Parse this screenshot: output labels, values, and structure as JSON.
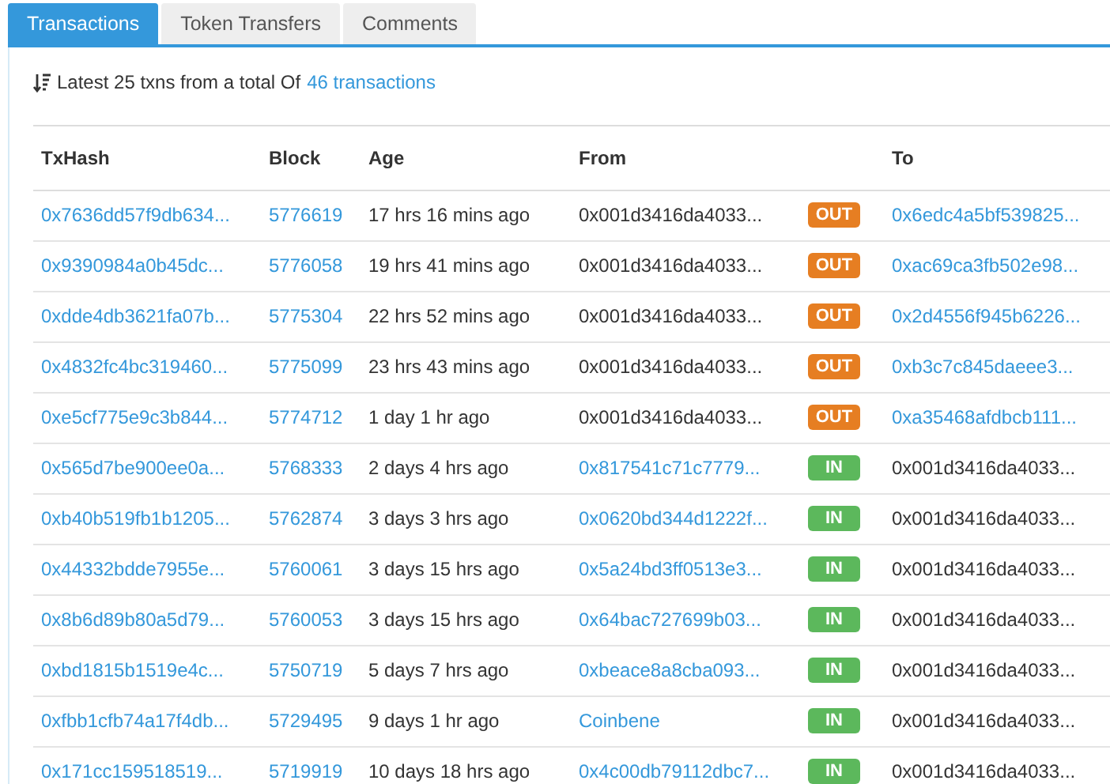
{
  "tabs": [
    {
      "label": "Transactions",
      "selected": true
    },
    {
      "label": "Token Transfers",
      "selected": false
    },
    {
      "label": "Comments",
      "selected": false
    }
  ],
  "summary": {
    "text": "Latest 25 txns from a total Of",
    "link": "46 transactions"
  },
  "table": {
    "columns": [
      "TxHash",
      "Block",
      "Age",
      "From",
      "",
      "To"
    ],
    "rows": [
      {
        "hash": "0x7636dd57f9db634...",
        "block": "5776619",
        "age": "17 hrs 16 mins ago",
        "from": {
          "text": "0x001d3416da4033...",
          "link": false
        },
        "direction": {
          "label": "OUT",
          "kind": "out"
        },
        "to": {
          "text": "0x6edc4a5bf539825...",
          "link": true
        }
      },
      {
        "hash": "0x9390984a0b45dc...",
        "block": "5776058",
        "age": "19 hrs 41 mins ago",
        "from": {
          "text": "0x001d3416da4033...",
          "link": false
        },
        "direction": {
          "label": "OUT",
          "kind": "out"
        },
        "to": {
          "text": "0xac69ca3fb502e98...",
          "link": true
        }
      },
      {
        "hash": "0xdde4db3621fa07b...",
        "block": "5775304",
        "age": "22 hrs 52 mins ago",
        "from": {
          "text": "0x001d3416da4033...",
          "link": false
        },
        "direction": {
          "label": "OUT",
          "kind": "out"
        },
        "to": {
          "text": "0x2d4556f945b6226...",
          "link": true
        }
      },
      {
        "hash": "0x4832fc4bc319460...",
        "block": "5775099",
        "age": "23 hrs 43 mins ago",
        "from": {
          "text": "0x001d3416da4033...",
          "link": false
        },
        "direction": {
          "label": "OUT",
          "kind": "out"
        },
        "to": {
          "text": "0xb3c7c845daeee3...",
          "link": true
        }
      },
      {
        "hash": "0xe5cf775e9c3b844...",
        "block": "5774712",
        "age": "1 day 1 hr ago",
        "from": {
          "text": "0x001d3416da4033...",
          "link": false
        },
        "direction": {
          "label": "OUT",
          "kind": "out"
        },
        "to": {
          "text": "0xa35468afdbcb111...",
          "link": true
        }
      },
      {
        "hash": "0x565d7be900ee0a...",
        "block": "5768333",
        "age": "2 days 4 hrs ago",
        "from": {
          "text": "0x817541c71c7779...",
          "link": true
        },
        "direction": {
          "label": "IN",
          "kind": "in"
        },
        "to": {
          "text": "0x001d3416da4033...",
          "link": false
        }
      },
      {
        "hash": "0xb40b519fb1b1205...",
        "block": "5762874",
        "age": "3 days 3 hrs ago",
        "from": {
          "text": "0x0620bd344d1222f...",
          "link": true
        },
        "direction": {
          "label": "IN",
          "kind": "in"
        },
        "to": {
          "text": "0x001d3416da4033...",
          "link": false
        }
      },
      {
        "hash": "0x44332bdde7955e...",
        "block": "5760061",
        "age": "3 days 15 hrs ago",
        "from": {
          "text": "0x5a24bd3ff0513e3...",
          "link": true
        },
        "direction": {
          "label": "IN",
          "kind": "in"
        },
        "to": {
          "text": "0x001d3416da4033...",
          "link": false
        }
      },
      {
        "hash": "0x8b6d89b80a5d79...",
        "block": "5760053",
        "age": "3 days 15 hrs ago",
        "from": {
          "text": "0x64bac727699b03...",
          "link": true
        },
        "direction": {
          "label": "IN",
          "kind": "in"
        },
        "to": {
          "text": "0x001d3416da4033...",
          "link": false
        }
      },
      {
        "hash": "0xbd1815b1519e4c...",
        "block": "5750719",
        "age": "5 days 7 hrs ago",
        "from": {
          "text": "0xbeace8a8cba093...",
          "link": true
        },
        "direction": {
          "label": "IN",
          "kind": "in"
        },
        "to": {
          "text": "0x001d3416da4033...",
          "link": false
        }
      },
      {
        "hash": "0xfbb1cfb74a17f4db...",
        "block": "5729495",
        "age": "9 days 1 hr ago",
        "from": {
          "text": "Coinbene",
          "link": true
        },
        "direction": {
          "label": "IN",
          "kind": "in"
        },
        "to": {
          "text": "0x001d3416da4033...",
          "link": false
        }
      },
      {
        "hash": "0x171cc159518519...",
        "block": "5719919",
        "age": "10 days 18 hrs ago",
        "from": {
          "text": "0x4c00db79112dbc7...",
          "link": true
        },
        "direction": {
          "label": "IN",
          "kind": "in"
        },
        "to": {
          "text": "0x001d3416da4033...",
          "link": false
        }
      }
    ]
  }
}
